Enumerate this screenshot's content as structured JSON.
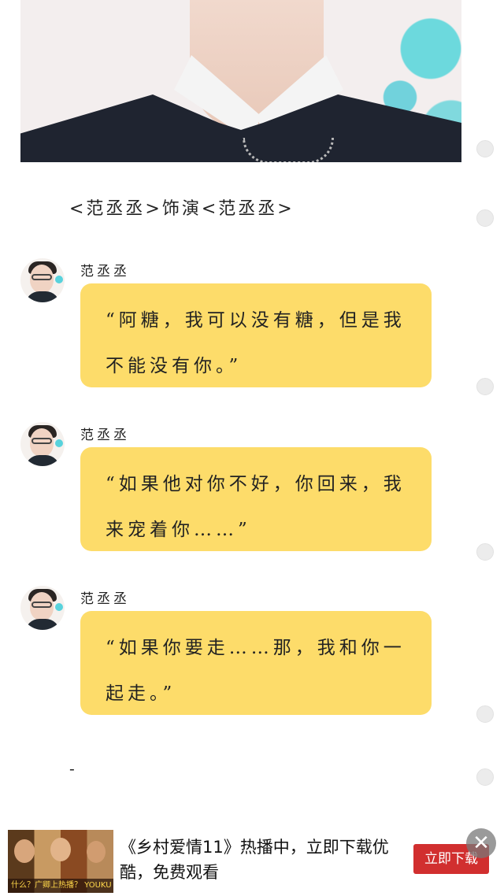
{
  "caption": "<范丞丞>饰演<范丞丞>",
  "messages": [
    {
      "name": "范丞丞",
      "text": "“阿糖，我可以没有糖，但是我不能没有你。”"
    },
    {
      "name": "范丞丞",
      "text": "“如果他对你不好，你回来，我来宠着你……”"
    },
    {
      "name": "范丞丞",
      "text": "“如果你要走……那，我和你一起走。”"
    }
  ],
  "trailing_text": "-",
  "ad": {
    "thumb_caption": "什么？广卿上热播？ YOUKU 优酷",
    "text": "《乡村爱情11》热播中，立即下载优酷，免费观看",
    "button": "立即下载",
    "close": "✕"
  },
  "colors": {
    "bubble": "#fddc6a",
    "ad_button": "#d12f2f"
  }
}
